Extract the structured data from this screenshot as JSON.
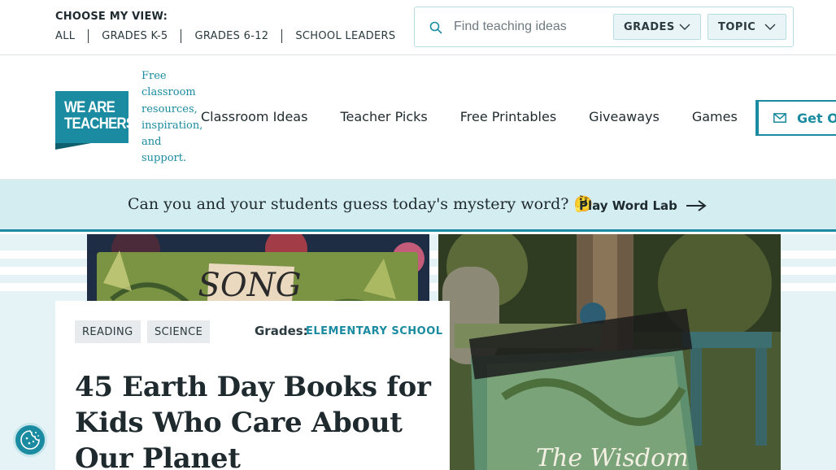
{
  "topbar": {
    "view_title": "CHOOSE MY VIEW:",
    "view_links": [
      "ALL",
      "GRADES K-5",
      "GRADES 6-12",
      "SCHOOL LEADERS"
    ],
    "search": {
      "placeholder": "Find teaching ideas",
      "icon": "search-icon"
    },
    "grades_dropdown": "GRADES",
    "topic_dropdown": "TOPIC"
  },
  "header": {
    "logo_line1": "WE ARE",
    "logo_line2": "TEACHERS",
    "tagline": "Free classroom resources, inspiration, and support.",
    "nav": [
      "Classroom Ideas",
      "Teacher Picks",
      "Free Printables",
      "Giveaways",
      "Games"
    ],
    "cta_label": "Get Ou",
    "cta_icon": "mail-icon"
  },
  "banner": {
    "text": "Can you and your students guess today's mystery word? 🤔",
    "link_label": "Play Word Lab"
  },
  "article": {
    "tags": [
      "READING",
      "SCIENCE"
    ],
    "grades_label": "Grades:",
    "grades_value": "ELEMENTARY SCHOOL",
    "title": "45 Earth Day Books for Kids Who Care About Our Planet",
    "image_left_text": "SONG",
    "image_right_text": "The Wisdom"
  },
  "colors": {
    "brand_teal": "#1a8ba0",
    "banner_bg": "#d3edf1",
    "hero_bg": "#e5f3f6"
  }
}
